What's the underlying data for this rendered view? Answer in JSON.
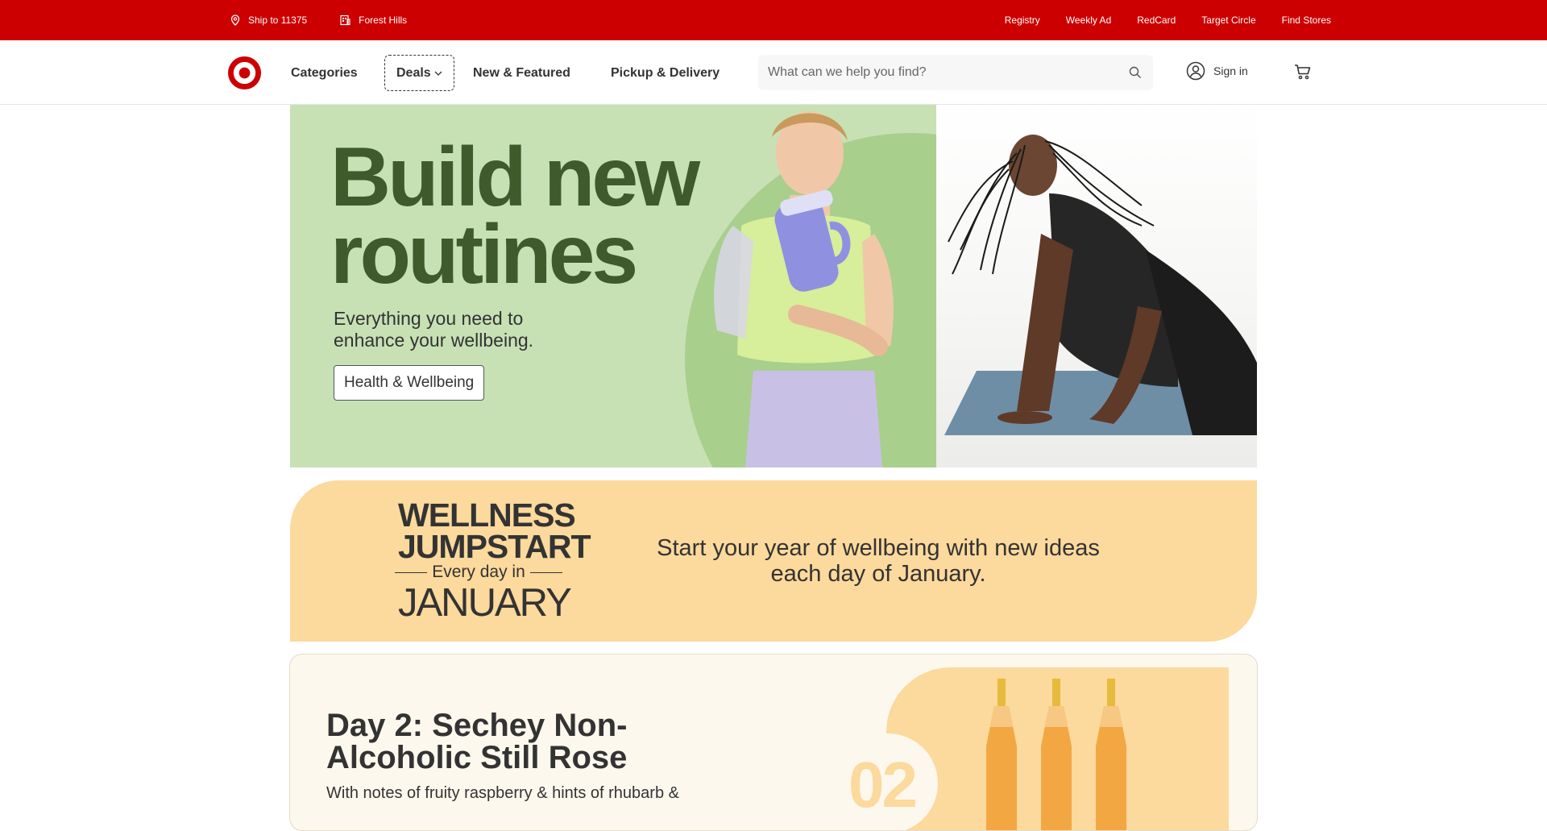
{
  "utility_bar": {
    "ship_to": "Ship to 11375",
    "store": "Forest Hills",
    "links": [
      "Registry",
      "Weekly Ad",
      "RedCard",
      "Target Circle",
      "Find Stores"
    ]
  },
  "header": {
    "nav": {
      "categories": "Categories",
      "deals": "Deals",
      "new_featured": "New & Featured",
      "pickup_delivery": "Pickup & Delivery"
    },
    "search_placeholder": "What can we help you find?",
    "sign_in": "Sign in"
  },
  "hero": {
    "title": "Build new routines",
    "subtitle": "Everything you need to enhance your wellbeing.",
    "button": "Health & Wellbeing"
  },
  "wellness_banner": {
    "logo_line1": "WELLNESS",
    "logo_line2": "JUMPSTART",
    "logo_line3": "Every day in",
    "logo_line4": "JANUARY",
    "text": "Start your year of wellbeing with new ideas each day of January."
  },
  "day_card": {
    "title": "Day 2: Sechey Non-Alcoholic Still Rose",
    "description": "With notes of fruity raspberry & hints of rhubarb &",
    "number": "02"
  },
  "colors": {
    "brand_red": "#cc0000",
    "hero_green": "#c7e1b5",
    "hero_title_green": "#3f5b2c",
    "wellness_orange": "#fcd99c"
  },
  "icons": [
    "location-pin-icon",
    "store-icon",
    "target-logo",
    "chevron-down-icon",
    "search-icon",
    "user-icon",
    "cart-icon"
  ]
}
